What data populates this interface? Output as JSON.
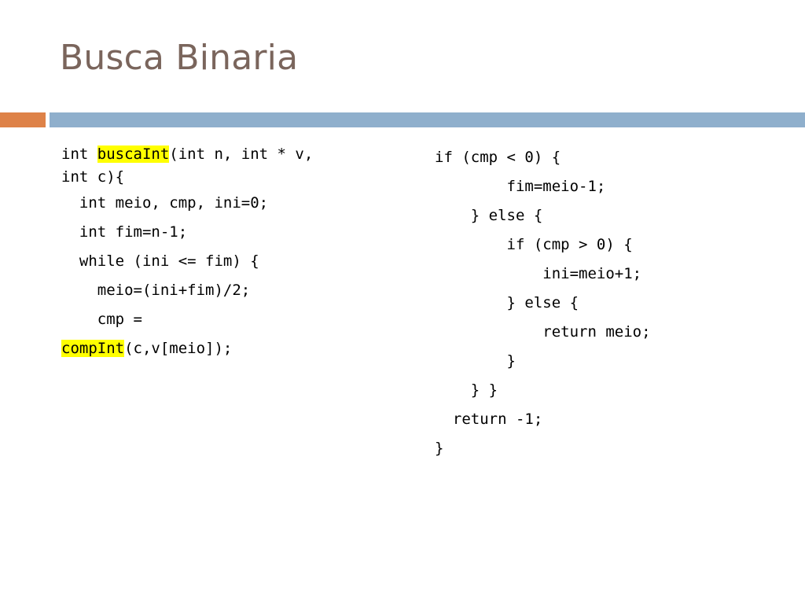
{
  "slide": {
    "title": "Busca Binaria",
    "colors": {
      "title_text": "#7a655c",
      "accent_square": "#de8248",
      "accent_bar": "#8fafcc",
      "highlight": "#ffff00",
      "code_text": "#000000",
      "background": "#ffffff"
    }
  },
  "code": {
    "left_column": [
      {
        "id": "l1",
        "indent": "",
        "pre": "int ",
        "highlight": "buscaInt",
        "post": "(int n, int * v,"
      },
      {
        "id": "l2",
        "indent": "",
        "pre": "int c){",
        "highlight": "",
        "post": ""
      },
      {
        "id": "l3",
        "indent": "  ",
        "pre": "int meio, cmp, ini=0;",
        "highlight": "",
        "post": ""
      },
      {
        "id": "l4",
        "indent": "  ",
        "pre": "int fim=n-1;",
        "highlight": "",
        "post": ""
      },
      {
        "id": "l5",
        "indent": "  ",
        "pre": "while (ini <= fim) {",
        "highlight": "",
        "post": ""
      },
      {
        "id": "l6",
        "indent": "    ",
        "pre": "meio=(ini+fim)/2;",
        "highlight": "",
        "post": ""
      },
      {
        "id": "l7",
        "indent": "    ",
        "pre": "cmp =",
        "highlight": "",
        "post": ""
      },
      {
        "id": "l8",
        "indent": "",
        "pre": "",
        "highlight": "compInt",
        "post": "(c,v[meio]);"
      }
    ],
    "right_column": [
      {
        "id": "r1",
        "indent": "",
        "text": "if (cmp < 0) {"
      },
      {
        "id": "r2",
        "indent": "        ",
        "text": "fim=meio-1;"
      },
      {
        "id": "r3",
        "indent": "    ",
        "text": "} else {"
      },
      {
        "id": "r4",
        "indent": "        ",
        "text": "if (cmp > 0) {"
      },
      {
        "id": "r5",
        "indent": "            ",
        "text": "ini=meio+1;"
      },
      {
        "id": "r6",
        "indent": "        ",
        "text": "} else {"
      },
      {
        "id": "r7",
        "indent": "            ",
        "text": "return meio;"
      },
      {
        "id": "r8",
        "indent": "        ",
        "text": "}"
      },
      {
        "id": "r9",
        "indent": "    ",
        "text": "} }"
      },
      {
        "id": "r10",
        "indent": "  ",
        "text": "return -1;"
      },
      {
        "id": "r11",
        "indent": "",
        "text": "}"
      }
    ]
  }
}
